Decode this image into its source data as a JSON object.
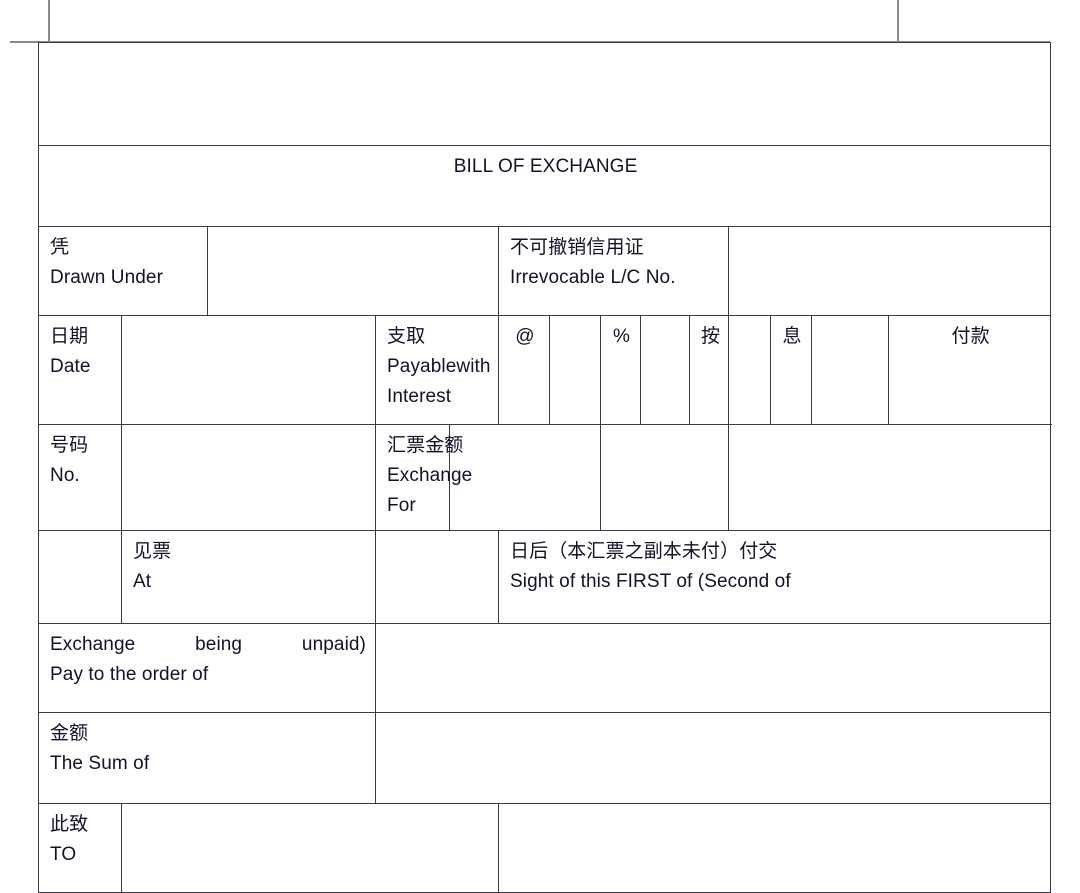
{
  "document": {
    "title": "BILL OF EXCHANGE",
    "accent_border": "#3a3a4a",
    "text_color": "#12122a",
    "crop_mark_color": "#8a8a8a"
  },
  "rows": {
    "header_blank": {
      "value": ""
    },
    "title": {
      "label": "BILL OF EXCHANGE"
    },
    "drawn_under": {
      "cn": "凭",
      "en": "Drawn Under",
      "value": "",
      "lc_cn": "不可撤销信用证",
      "lc_en": "Irrevocable L/C No.",
      "lc_value": ""
    },
    "date": {
      "cn": "日期",
      "en": "Date",
      "value": "",
      "payable_cn": "支取",
      "payable_en_left": "Payable",
      "payable_en_right": "with",
      "payable_en_2": "Interest",
      "at_symbol": "@",
      "rate_value": "",
      "percent_symbol": "%",
      "spacer_1": "",
      "an_cn": "按",
      "spacer_2": "",
      "xi_cn": "息",
      "spacer_3": "",
      "fukuan_cn": "付款"
    },
    "number": {
      "cn": "号码",
      "en": "No.",
      "value": "",
      "exchange_cn": "汇票金额",
      "exchange_en_1": "Exchange",
      "exchange_en_2": "For",
      "amount_value": "",
      "col_3": "",
      "col_4": ""
    },
    "at_sight": {
      "left_blank": "",
      "cn": "见票",
      "en": "At",
      "mid_blank": "",
      "sight_cn": "日后（本汇票之副本未付）付交",
      "sight_en": "Sight of this FIRST of (Second of"
    },
    "pay_order": {
      "en_line1_left": "Exchange",
      "en_line1_mid": "being",
      "en_line1_right": "unpaid)",
      "en_line2": "Pay to the order of",
      "value": ""
    },
    "sum_of": {
      "cn": "金额",
      "en": "The Sum of",
      "value": ""
    },
    "to": {
      "cn": "此致",
      "en": "TO",
      "value": "",
      "right_value": ""
    }
  }
}
